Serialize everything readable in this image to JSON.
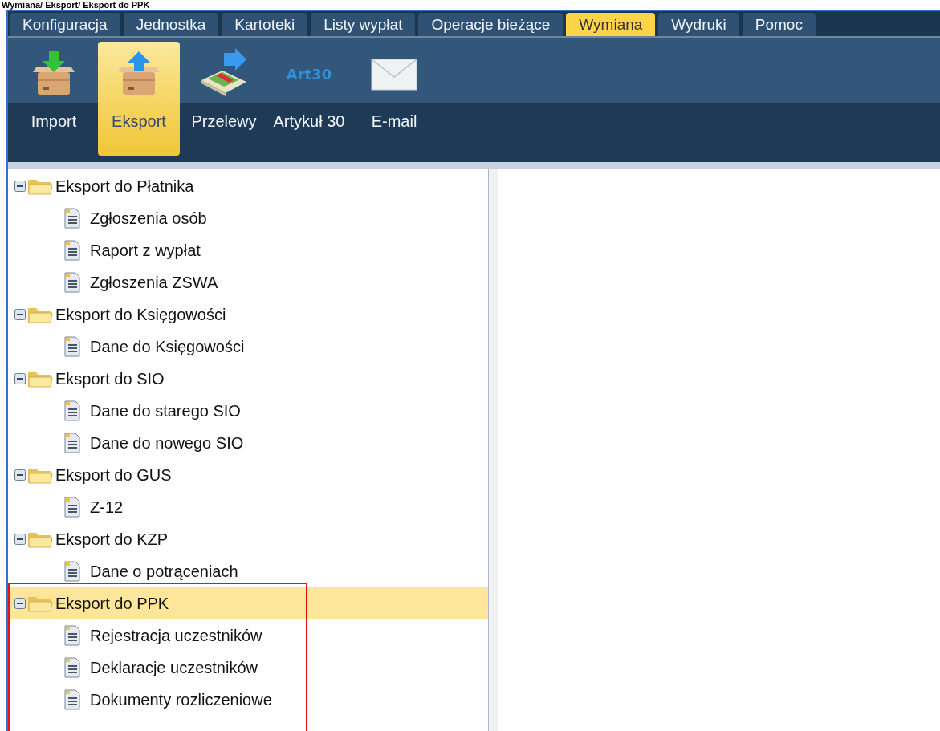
{
  "breadcrumb": "Wymiana/ Eksport/ Eksport do PPK",
  "tabs": [
    {
      "label": "Konfiguracja",
      "selected": false
    },
    {
      "label": "Jednostka",
      "selected": false
    },
    {
      "label": "Kartoteki",
      "selected": false
    },
    {
      "label": "Listy wypłat",
      "selected": false
    },
    {
      "label": "Operacje bieżące",
      "selected": false
    },
    {
      "label": "Wymiana",
      "selected": true
    },
    {
      "label": "Wydruki",
      "selected": false
    },
    {
      "label": "Pomoc",
      "selected": false
    }
  ],
  "toolbar": [
    {
      "kind": "import",
      "label": "Import",
      "selected": false
    },
    {
      "kind": "export",
      "label": "Eksport",
      "selected": true
    },
    {
      "kind": "transfer",
      "label": "Przelewy",
      "selected": false
    },
    {
      "kind": "text",
      "icon_text": "Art30",
      "label": "Artykuł 30",
      "selected": false
    },
    {
      "kind": "mail",
      "label": "E-mail",
      "selected": false
    }
  ],
  "tree": [
    {
      "label": "Eksport do Płatnika",
      "expanded": true,
      "selected": false,
      "outlined": false,
      "children": [
        {
          "label": "Zgłoszenia osób",
          "selected": false
        },
        {
          "label": "Raport z wypłat",
          "selected": false
        },
        {
          "label": "Zgłoszenia ZSWA",
          "selected": false
        }
      ]
    },
    {
      "label": "Eksport do Księgowości",
      "expanded": true,
      "selected": false,
      "outlined": false,
      "children": [
        {
          "label": "Dane do Księgowości",
          "selected": false
        }
      ]
    },
    {
      "label": "Eksport do SIO",
      "expanded": true,
      "selected": false,
      "outlined": false,
      "children": [
        {
          "label": "Dane do starego SIO",
          "selected": false
        },
        {
          "label": "Dane do nowego SIO",
          "selected": false
        }
      ]
    },
    {
      "label": "Eksport do GUS",
      "expanded": true,
      "selected": false,
      "outlined": false,
      "children": [
        {
          "label": "Z-12",
          "selected": false
        }
      ]
    },
    {
      "label": "Eksport do KZP",
      "expanded": true,
      "selected": false,
      "outlined": false,
      "children": [
        {
          "label": "Dane o potrąceniach",
          "selected": false
        }
      ]
    },
    {
      "label": "Eksport do PPK",
      "expanded": true,
      "selected": true,
      "outlined": true,
      "children": [
        {
          "label": "Rejestracja uczestników",
          "selected": false
        },
        {
          "label": "Deklaracje uczestników",
          "selected": false
        },
        {
          "label": "Dokumenty rozliczeniowe",
          "selected": false
        }
      ]
    }
  ]
}
